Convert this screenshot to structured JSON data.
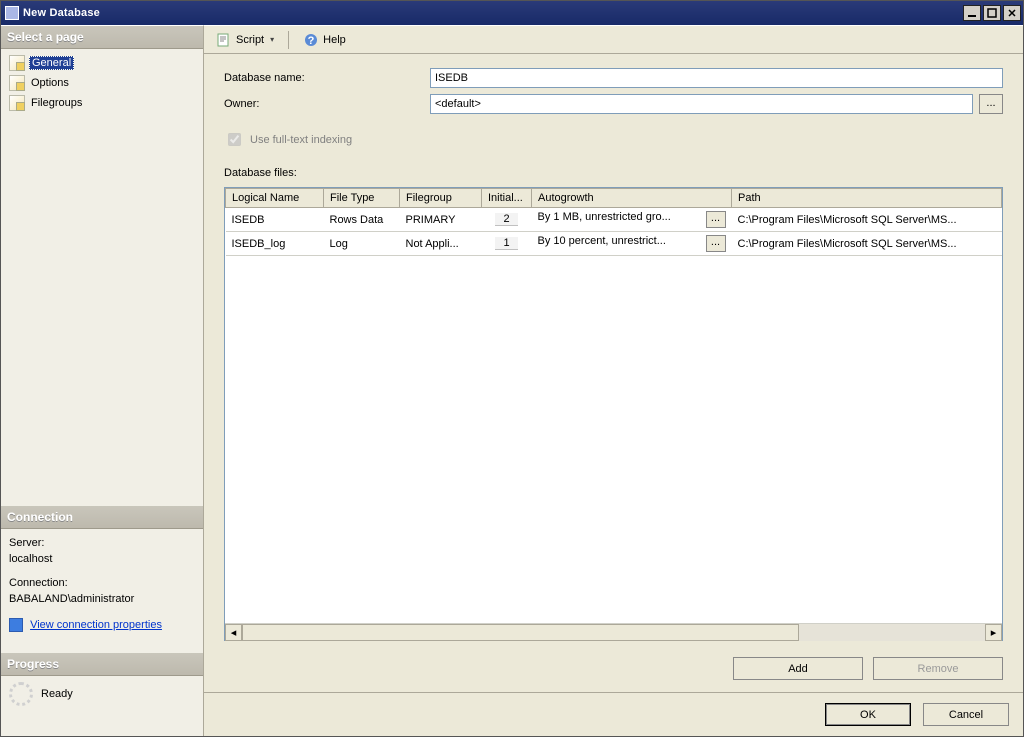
{
  "window": {
    "title": "New Database"
  },
  "sidebar": {
    "select_page": "Select a page",
    "items": [
      {
        "label": "General",
        "selected": true
      },
      {
        "label": "Options",
        "selected": false
      },
      {
        "label": "Filegroups",
        "selected": false
      }
    ],
    "connection_head": "Connection",
    "server_label": "Server:",
    "server_value": "localhost",
    "conn_label": "Connection:",
    "conn_value": "BABALAND\\administrator",
    "view_conn_props": "View connection properties",
    "progress_head": "Progress",
    "progress_status": "Ready"
  },
  "toolbar": {
    "script": "Script",
    "help": "Help"
  },
  "form": {
    "dbname_label": "Database name:",
    "dbname_value": "ISEDB",
    "owner_label": "Owner:",
    "owner_value": "<default>",
    "browse": "...",
    "fulltext_label": "Use full-text indexing",
    "files_label": "Database files:"
  },
  "grid": {
    "columns": {
      "logical_name": "Logical Name",
      "file_type": "File Type",
      "filegroup": "Filegroup",
      "initial": "Initial...",
      "autogrowth": "Autogrowth",
      "path": "Path"
    },
    "rows": [
      {
        "logical_name": "ISEDB",
        "file_type": "Rows Data",
        "filegroup": "PRIMARY",
        "initial": "2",
        "autogrowth": "By 1 MB, unrestricted gro...",
        "path": "C:\\Program Files\\Microsoft SQL Server\\MS..."
      },
      {
        "logical_name": "ISEDB_log",
        "file_type": "Log",
        "filegroup": "Not Appli...",
        "initial": "1",
        "autogrowth": "By 10 percent, unrestrict...",
        "path": "C:\\Program Files\\Microsoft SQL Server\\MS..."
      }
    ],
    "ellipsis": "..."
  },
  "buttons": {
    "add": "Add",
    "remove": "Remove",
    "ok": "OK",
    "cancel": "Cancel"
  }
}
